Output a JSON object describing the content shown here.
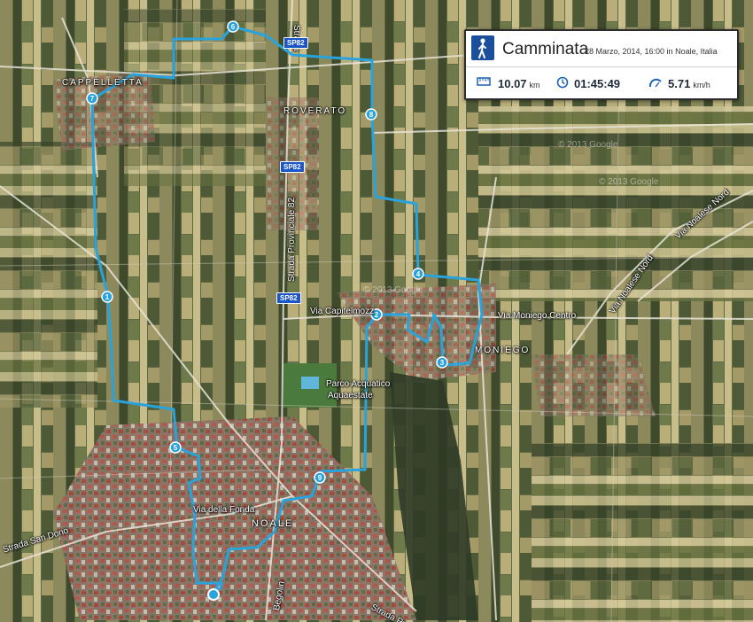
{
  "activity": {
    "title": "Camminata",
    "subtitle": "28 Marzo, 2014, 16:00 in Noale, Italia",
    "distance_value": "10.07",
    "distance_unit": "km",
    "duration": "01:45:49",
    "speed_value": "5.71",
    "speed_unit": "km/h",
    "icon": "walking-person-icon"
  },
  "places": {
    "cappelletta": "CAPPELLETTA",
    "roverato": "ROVERATO",
    "moniego": "MONIEGO",
    "noale": "NOALE",
    "via_capitelmozz": "Via Capitelmozz",
    "via_moniego_centro": "Via Moniego Centro",
    "parco_line1": "Parco Acquatico",
    "parco_line2": "Aquaestate",
    "via_della_fonda": "Via della Fonda",
    "strada_san_dono": "Strada San Dono",
    "strada_provinciale_82": "Strada Provinciale 82",
    "strada_provinciale_bottom": "Strada Provinciale",
    "via_noalese_nord": "Via Noalese Nord",
    "via_noalese_nord_2": "Via Noalese Nord",
    "begolin": "Begolin",
    "strada_top": "Strada"
  },
  "road_shields": [
    "SP82",
    "SP82",
    "SP82"
  ],
  "route": {
    "color": "#29a3dc",
    "markers": [
      {
        "label": "1"
      },
      {
        "label": "2"
      },
      {
        "label": "3"
      },
      {
        "label": "4"
      },
      {
        "label": "5"
      },
      {
        "label": "6"
      },
      {
        "label": "7"
      },
      {
        "label": "8"
      },
      {
        "label": "9"
      }
    ],
    "start_marker": "start-finish-marker"
  },
  "watermarks": [
    "© 2013 Google",
    "© 2013 Google",
    "© 2013 Google"
  ]
}
